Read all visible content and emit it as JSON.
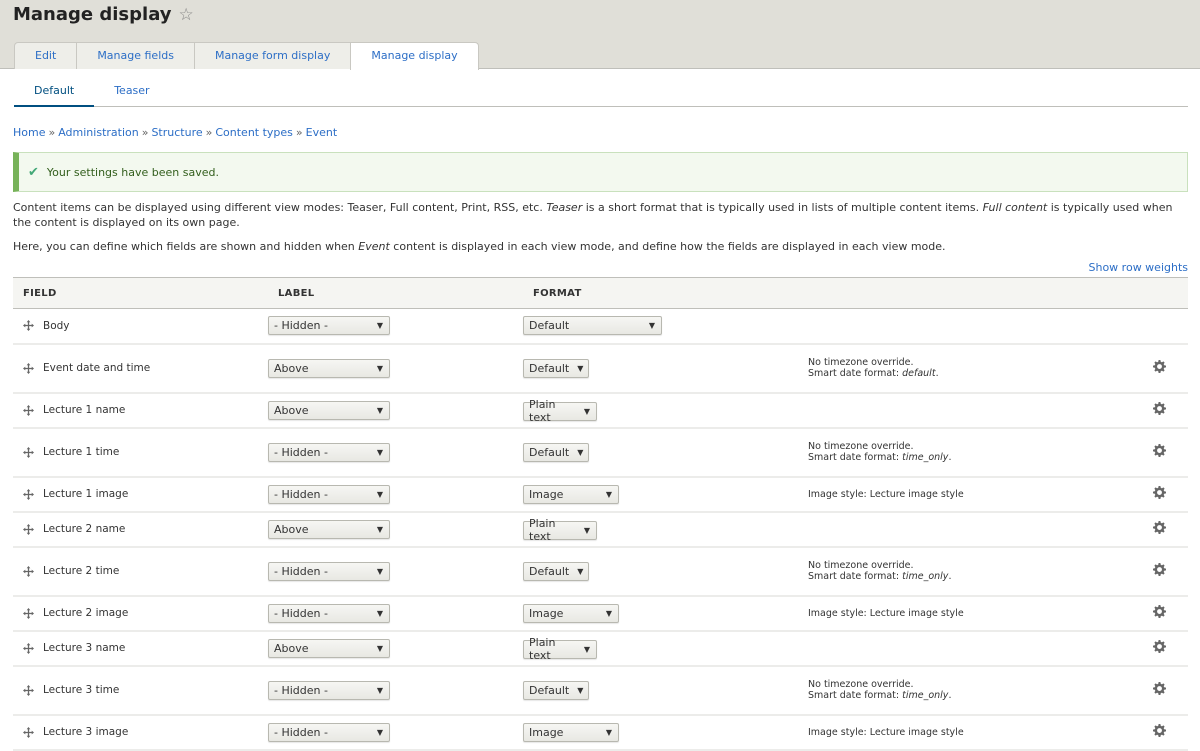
{
  "header": {
    "title": "Manage display",
    "star_icon": "star-outline-icon",
    "primary_tabs": [
      {
        "label": "Edit",
        "active": false
      },
      {
        "label": "Manage fields",
        "active": false
      },
      {
        "label": "Manage form display",
        "active": false
      },
      {
        "label": "Manage display",
        "active": true
      }
    ],
    "secondary_tabs": [
      {
        "label": "Default",
        "active": true
      },
      {
        "label": "Teaser",
        "active": false
      }
    ]
  },
  "breadcrumb": {
    "items": [
      "Home",
      "Administration",
      "Structure",
      "Content types",
      "Event"
    ],
    "separator": "»"
  },
  "message": {
    "icon": "check-icon",
    "text": "Your settings have been saved.",
    "type": "status",
    "color": "#77b259"
  },
  "description": {
    "p1_part1": "Content items can be displayed using different view modes: Teaser, Full content, Print, RSS, etc. ",
    "p1_em1": "Teaser",
    "p1_part2": " is a short format that is typically used in lists of multiple content items. ",
    "p1_em2": "Full content",
    "p1_part3": " is typically used when the content is displayed on its own page.",
    "p2_part1": "Here, you can define which fields are shown and hidden when ",
    "p2_em": "Event",
    "p2_part2": " content is displayed in each view mode, and define how the fields are displayed in each view mode."
  },
  "show_row_weights": "Show row weights",
  "table": {
    "headers": {
      "field": "FIELD",
      "label": "LABEL",
      "format": "FORMAT"
    },
    "rows": [
      {
        "field": "Body",
        "label": "- Hidden -",
        "format": "Default",
        "summary1": "",
        "summary2_prefix": "",
        "summary2_em": "",
        "summary2_suffix": "",
        "gear": false
      },
      {
        "field": "Event date and time",
        "label": "Above",
        "format": "Default",
        "summary1": "No timezone override.",
        "summary2_prefix": "Smart date format: ",
        "summary2_em": "default",
        "summary2_suffix": ".",
        "gear": true
      },
      {
        "field": "Lecture 1 name",
        "label": "Above",
        "format": "Plain text",
        "summary1": "",
        "summary2_prefix": "",
        "summary2_em": "",
        "summary2_suffix": "",
        "gear": true
      },
      {
        "field": "Lecture 1 time",
        "label": "- Hidden -",
        "format": "Default",
        "summary1": "No timezone override.",
        "summary2_prefix": "Smart date format: ",
        "summary2_em": "time_only",
        "summary2_suffix": ".",
        "gear": true
      },
      {
        "field": "Lecture 1 image",
        "label": "- Hidden -",
        "format": "Image",
        "summary1": "Image style: Lecture image style",
        "summary2_prefix": "",
        "summary2_em": "",
        "summary2_suffix": "",
        "gear": true
      },
      {
        "field": "Lecture 2 name",
        "label": "Above",
        "format": "Plain text",
        "summary1": "",
        "summary2_prefix": "",
        "summary2_em": "",
        "summary2_suffix": "",
        "gear": true
      },
      {
        "field": "Lecture 2 time",
        "label": "- Hidden -",
        "format": "Default",
        "summary1": "No timezone override.",
        "summary2_prefix": "Smart date format: ",
        "summary2_em": "time_only",
        "summary2_suffix": ".",
        "gear": true
      },
      {
        "field": "Lecture 2 image",
        "label": "- Hidden -",
        "format": "Image",
        "summary1": "Image style: Lecture image style",
        "summary2_prefix": "",
        "summary2_em": "",
        "summary2_suffix": "",
        "gear": true
      },
      {
        "field": "Lecture 3 name",
        "label": "Above",
        "format": "Plain text",
        "summary1": "",
        "summary2_prefix": "",
        "summary2_em": "",
        "summary2_suffix": "",
        "gear": true
      },
      {
        "field": "Lecture 3 time",
        "label": "- Hidden -",
        "format": "Default",
        "summary1": "No timezone override.",
        "summary2_prefix": "Smart date format: ",
        "summary2_em": "time_only",
        "summary2_suffix": ".",
        "gear": true
      },
      {
        "field": "Lecture 3 image",
        "label": "- Hidden -",
        "format": "Image",
        "summary1": "Image style: Lecture image style",
        "summary2_prefix": "",
        "summary2_em": "",
        "summary2_suffix": "",
        "gear": true
      }
    ]
  }
}
